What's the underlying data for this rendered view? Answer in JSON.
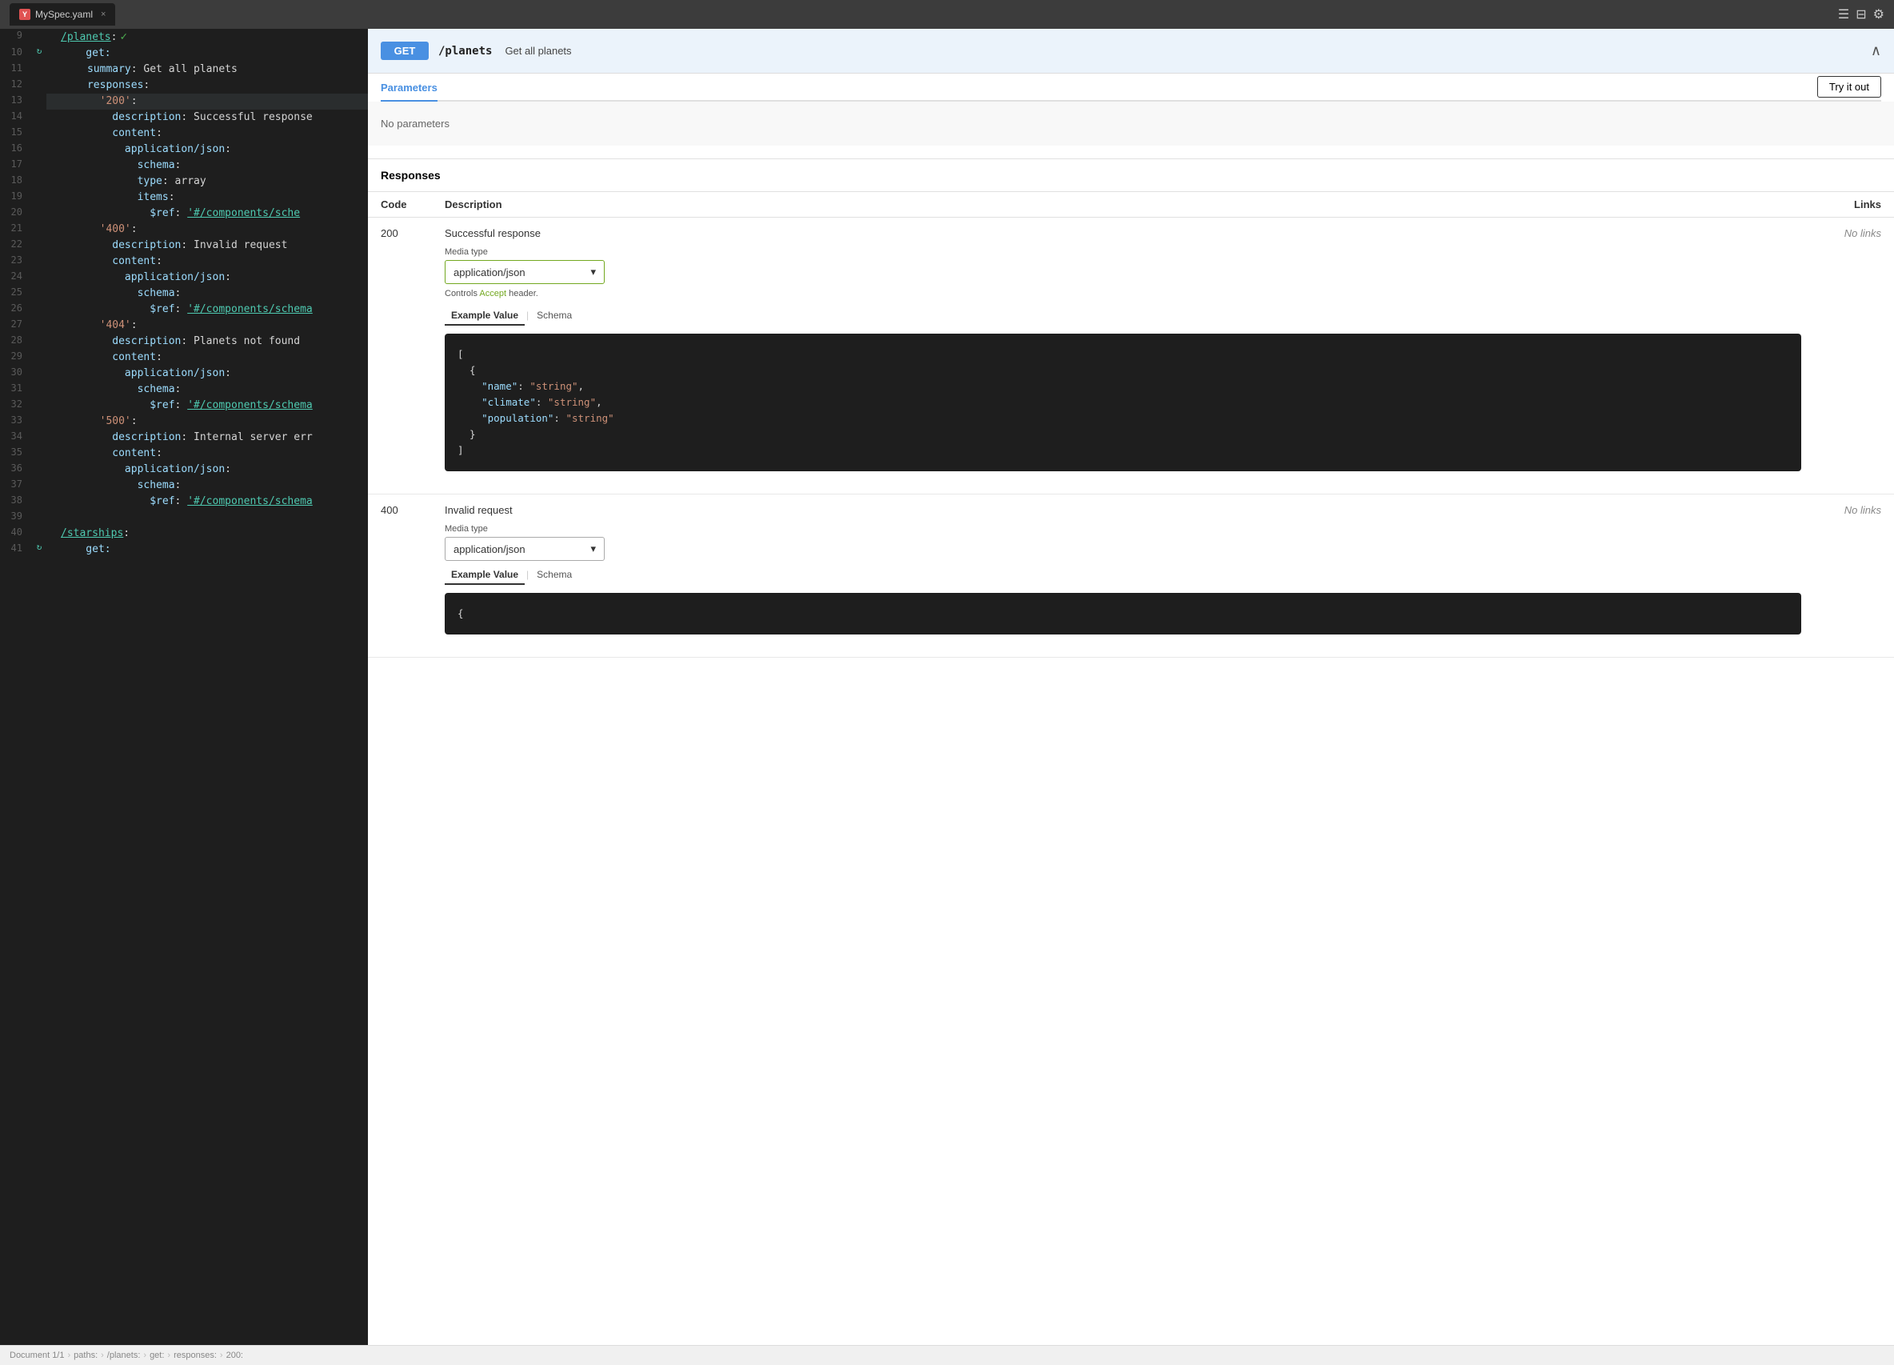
{
  "titleBar": {
    "tab": {
      "label": "MySpec.yaml",
      "icon": "Y",
      "iconBg": "#e05252"
    },
    "icons": [
      "menu-icon",
      "split-icon",
      "settings-icon"
    ]
  },
  "editor": {
    "lines": [
      {
        "num": 9,
        "indent": 1,
        "content": [
          {
            "type": "link",
            "text": "/planets"
          },
          {
            "type": "plain",
            "text": ":"
          }
        ],
        "hasCheck": true,
        "hasRefresh": false,
        "highlighted": false
      },
      {
        "num": 10,
        "indent": 1,
        "content": [
          {
            "type": "key",
            "text": "    get:"
          }
        ],
        "hasCheck": false,
        "hasRefresh": true,
        "highlighted": false
      },
      {
        "num": 11,
        "indent": 2,
        "content": [
          {
            "type": "key",
            "text": "      summary"
          },
          {
            "type": "plain",
            "text": ": "
          },
          {
            "type": "plain",
            "text": "Get all planets"
          }
        ],
        "hasCheck": false,
        "hasRefresh": false,
        "highlighted": false
      },
      {
        "num": 12,
        "indent": 2,
        "content": [
          {
            "type": "key",
            "text": "      responses"
          },
          {
            "type": "plain",
            "text": ":"
          }
        ],
        "hasCheck": false,
        "hasRefresh": false,
        "highlighted": false
      },
      {
        "num": 13,
        "indent": 3,
        "content": [
          {
            "type": "str",
            "text": "        '200'"
          },
          {
            "type": "plain",
            "text": ":"
          }
        ],
        "hasCheck": false,
        "hasRefresh": false,
        "highlighted": true
      },
      {
        "num": 14,
        "indent": 4,
        "content": [
          {
            "type": "key",
            "text": "          description"
          },
          {
            "type": "plain",
            "text": ": Successful response"
          }
        ],
        "hasCheck": false,
        "hasRefresh": false,
        "highlighted": false
      },
      {
        "num": 15,
        "indent": 4,
        "content": [
          {
            "type": "key",
            "text": "          content"
          },
          {
            "type": "plain",
            "text": ":"
          }
        ],
        "hasCheck": false,
        "hasRefresh": false,
        "highlighted": false
      },
      {
        "num": 16,
        "indent": 5,
        "content": [
          {
            "type": "key",
            "text": "            application/json"
          },
          {
            "type": "plain",
            "text": ":"
          }
        ],
        "hasCheck": false,
        "hasRefresh": false,
        "highlighted": false
      },
      {
        "num": 17,
        "indent": 6,
        "content": [
          {
            "type": "key",
            "text": "              schema"
          },
          {
            "type": "plain",
            "text": ":"
          }
        ],
        "hasCheck": false,
        "hasRefresh": false,
        "highlighted": false
      },
      {
        "num": 18,
        "indent": 6,
        "content": [
          {
            "type": "key",
            "text": "              type"
          },
          {
            "type": "plain",
            "text": ": array"
          }
        ],
        "hasCheck": false,
        "hasRefresh": false,
        "highlighted": false
      },
      {
        "num": 19,
        "indent": 6,
        "content": [
          {
            "type": "key",
            "text": "              items"
          },
          {
            "type": "plain",
            "text": ":"
          }
        ],
        "hasCheck": false,
        "hasRefresh": false,
        "highlighted": false
      },
      {
        "num": 20,
        "indent": 6,
        "content": [
          {
            "type": "key",
            "text": "                $ref"
          },
          {
            "type": "plain",
            "text": ": "
          },
          {
            "type": "link",
            "text": "'#/components/sche"
          }
        ],
        "hasCheck": false,
        "hasRefresh": false,
        "highlighted": false
      },
      {
        "num": 21,
        "indent": 3,
        "content": [
          {
            "type": "str",
            "text": "        '400'"
          },
          {
            "type": "plain",
            "text": ":"
          }
        ],
        "hasCheck": false,
        "hasRefresh": false,
        "highlighted": false
      },
      {
        "num": 22,
        "indent": 4,
        "content": [
          {
            "type": "key",
            "text": "          description"
          },
          {
            "type": "plain",
            "text": ": Invalid request"
          }
        ],
        "hasCheck": false,
        "hasRefresh": false,
        "highlighted": false
      },
      {
        "num": 23,
        "indent": 4,
        "content": [
          {
            "type": "key",
            "text": "          content"
          },
          {
            "type": "plain",
            "text": ":"
          }
        ],
        "hasCheck": false,
        "hasRefresh": false,
        "highlighted": false
      },
      {
        "num": 24,
        "indent": 5,
        "content": [
          {
            "type": "key",
            "text": "            application/json"
          },
          {
            "type": "plain",
            "text": ":"
          }
        ],
        "hasCheck": false,
        "hasRefresh": false,
        "highlighted": false
      },
      {
        "num": 25,
        "indent": 6,
        "content": [
          {
            "type": "key",
            "text": "              schema"
          },
          {
            "type": "plain",
            "text": ":"
          }
        ],
        "hasCheck": false,
        "hasRefresh": false,
        "highlighted": false
      },
      {
        "num": 26,
        "indent": 6,
        "content": [
          {
            "type": "key",
            "text": "                $ref"
          },
          {
            "type": "plain",
            "text": ": "
          },
          {
            "type": "link",
            "text": "'#/components/schema"
          }
        ],
        "hasCheck": false,
        "hasRefresh": false,
        "highlighted": false
      },
      {
        "num": 27,
        "indent": 3,
        "content": [
          {
            "type": "str",
            "text": "        '404'"
          },
          {
            "type": "plain",
            "text": ":"
          }
        ],
        "hasCheck": false,
        "hasRefresh": false,
        "highlighted": false
      },
      {
        "num": 28,
        "indent": 4,
        "content": [
          {
            "type": "key",
            "text": "          description"
          },
          {
            "type": "plain",
            "text": ": Planets not found"
          }
        ],
        "hasCheck": false,
        "hasRefresh": false,
        "highlighted": false
      },
      {
        "num": 29,
        "indent": 4,
        "content": [
          {
            "type": "key",
            "text": "          content"
          },
          {
            "type": "plain",
            "text": ":"
          }
        ],
        "hasCheck": false,
        "hasRefresh": false,
        "highlighted": false
      },
      {
        "num": 30,
        "indent": 5,
        "content": [
          {
            "type": "key",
            "text": "            application/json"
          },
          {
            "type": "plain",
            "text": ":"
          }
        ],
        "hasCheck": false,
        "hasRefresh": false,
        "highlighted": false
      },
      {
        "num": 31,
        "indent": 6,
        "content": [
          {
            "type": "key",
            "text": "              schema"
          },
          {
            "type": "plain",
            "text": ":"
          }
        ],
        "hasCheck": false,
        "hasRefresh": false,
        "highlighted": false
      },
      {
        "num": 32,
        "indent": 6,
        "content": [
          {
            "type": "key",
            "text": "                $ref"
          },
          {
            "type": "plain",
            "text": ": "
          },
          {
            "type": "link",
            "text": "'#/components/schema"
          }
        ],
        "hasCheck": false,
        "hasRefresh": false,
        "highlighted": false
      },
      {
        "num": 33,
        "indent": 3,
        "content": [
          {
            "type": "str",
            "text": "        '500'"
          },
          {
            "type": "plain",
            "text": ":"
          }
        ],
        "hasCheck": false,
        "hasRefresh": false,
        "highlighted": false
      },
      {
        "num": 34,
        "indent": 4,
        "content": [
          {
            "type": "key",
            "text": "          description"
          },
          {
            "type": "plain",
            "text": ": Internal server err"
          }
        ],
        "hasCheck": false,
        "hasRefresh": false,
        "highlighted": false
      },
      {
        "num": 35,
        "indent": 4,
        "content": [
          {
            "type": "key",
            "text": "          content"
          },
          {
            "type": "plain",
            "text": ":"
          }
        ],
        "hasCheck": false,
        "hasRefresh": false,
        "highlighted": false
      },
      {
        "num": 36,
        "indent": 5,
        "content": [
          {
            "type": "key",
            "text": "            application/json"
          },
          {
            "type": "plain",
            "text": ":"
          }
        ],
        "hasCheck": false,
        "hasRefresh": false,
        "highlighted": false
      },
      {
        "num": 37,
        "indent": 6,
        "content": [
          {
            "type": "key",
            "text": "              schema"
          },
          {
            "type": "plain",
            "text": ":"
          }
        ],
        "hasCheck": false,
        "hasRefresh": false,
        "highlighted": false
      },
      {
        "num": 38,
        "indent": 6,
        "content": [
          {
            "type": "key",
            "text": "                $ref"
          },
          {
            "type": "plain",
            "text": ": "
          },
          {
            "type": "link",
            "text": "'#/components/schema"
          }
        ],
        "hasCheck": false,
        "hasRefresh": false,
        "highlighted": false
      },
      {
        "num": 39,
        "indent": 0,
        "content": [],
        "hasCheck": false,
        "hasRefresh": false,
        "highlighted": false
      },
      {
        "num": 40,
        "indent": 1,
        "content": [
          {
            "type": "link",
            "text": "/starships"
          },
          {
            "type": "plain",
            "text": ":"
          }
        ],
        "hasCheck": false,
        "hasRefresh": false,
        "highlighted": false
      },
      {
        "num": 41,
        "indent": 1,
        "content": [
          {
            "type": "key",
            "text": "    get:"
          }
        ],
        "hasCheck": false,
        "hasRefresh": true,
        "highlighted": false
      }
    ]
  },
  "swagger": {
    "endpoint": {
      "method": "GET",
      "path": "/planets",
      "summary": "Get all planets",
      "methodColor": "#4990e2"
    },
    "parametersTab": "Parameters",
    "tryItOutLabel": "Try it out",
    "noParameters": "No parameters",
    "responsesLabel": "Responses",
    "tableHeaders": {
      "code": "Code",
      "description": "Description",
      "links": "Links"
    },
    "responses": [
      {
        "code": "200",
        "description": "Successful response",
        "noLinks": "No links",
        "mediaTypeLabel": "Media type",
        "mediaTypeValue": "application/json",
        "controlsText1": "Controls ",
        "controlsLink": "Accept",
        "controlsText2": " header.",
        "exampleValueLabel": "Example Value",
        "schemaLabel": "Schema",
        "codeExample": "[\n  {\n    \"name\": \"string\",\n    \"climate\": \"string\",\n    \"population\": \"string\"\n  }\n]"
      },
      {
        "code": "400",
        "description": "Invalid request",
        "noLinks": "No links",
        "mediaTypeLabel": "Media type",
        "mediaTypeValue": "application/json",
        "hasCodeBlock": true,
        "openBrace": "{"
      }
    ]
  },
  "breadcrumb": {
    "items": [
      "Document 1/1",
      "paths:",
      "/planets:",
      "get:",
      "responses:",
      "200:"
    ],
    "separators": [
      "›",
      "›",
      "›",
      "›",
      "›"
    ]
  }
}
